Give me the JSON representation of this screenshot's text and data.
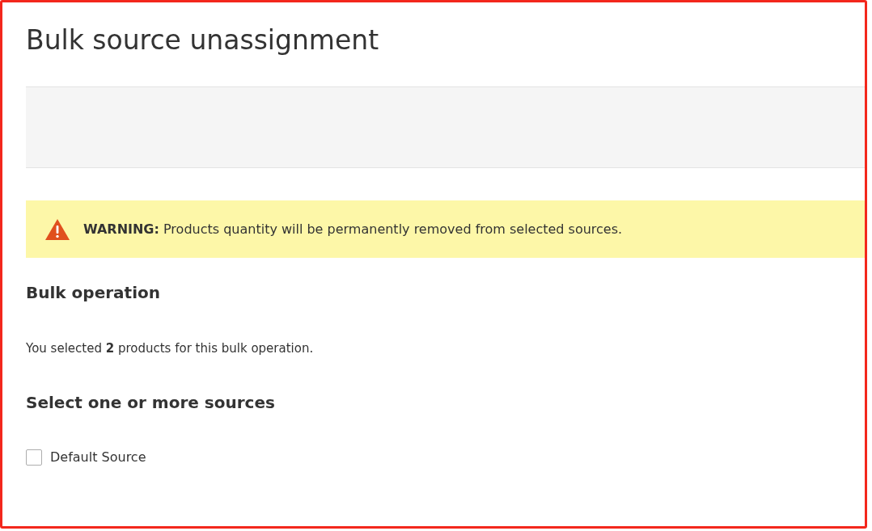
{
  "page_title": "Bulk source unassignment",
  "warning": {
    "message": "**WARNING:** Products quantity will be permanently removed from selected sources."
  },
  "bulk_operation": {
    "heading": "Bulk operation",
    "summary": "You selected **2** products for this bulk operation."
  },
  "sources": {
    "heading": "Select one or more sources",
    "items": [
      {
        "label": "Default Source",
        "checked": false
      }
    ]
  }
}
